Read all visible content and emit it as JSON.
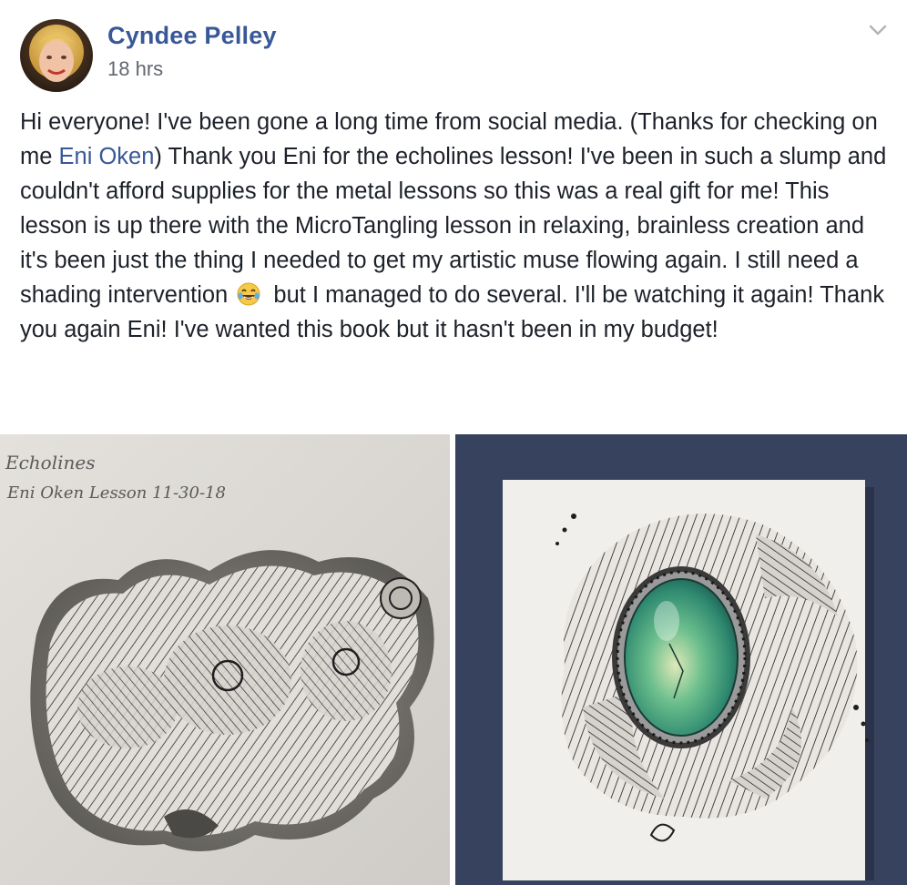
{
  "post": {
    "author": "Cyndee Pelley",
    "timestamp": "18 hrs",
    "text_parts": {
      "p1": "Hi everyone! I've been gone a long time from social media. (Thanks for checking on me ",
      "mention": "Eni Oken",
      "p2": ") Thank you Eni for the echolines lesson! I've been in such a slump and couldn't afford supplies for the metal lessons so this was a real gift for me! This lesson is up there with the MicroTangling lesson in relaxing, brainless creation and it's been just the thing I needed to get my artistic muse flowing again. I still need a shading intervention",
      "p3": " but I managed to do several. I'll be watching it again! Thank you again Eni! I've wanted this book but it hasn't been in my budget!"
    },
    "emoji": "laughing-tears-emoji",
    "photos": [
      {
        "name": "echolines-drawing-photo",
        "handwriting_line1": "Echolines",
        "handwriting_line2": "Eni Oken Lesson 11-30-18"
      },
      {
        "name": "gem-tangle-drawing-photo",
        "gem_color": "#3f9e6e"
      }
    ]
  },
  "colors": {
    "link": "#385898",
    "text": "#1d2129",
    "meta": "#616770",
    "board": "#3e4a66"
  }
}
